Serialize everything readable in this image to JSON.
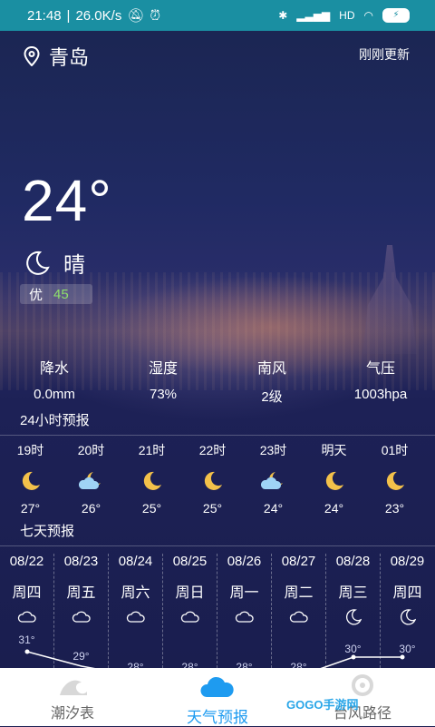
{
  "status_bar": {
    "time": "21:48",
    "speed": "26.0K/s",
    "signal_icons": [
      "bluetooth-icon",
      "cellular-icon",
      "hd-icon",
      "wifi-icon",
      "battery-icon"
    ],
    "battery_icon": "battery-charging-icon"
  },
  "header": {
    "location": "青岛",
    "updated": "刚刚更新"
  },
  "current": {
    "temperature": "24°",
    "condition": "晴",
    "condition_icon": "moon-icon",
    "aqi_label": "优",
    "aqi_value": "45"
  },
  "stats": [
    {
      "label": "降水",
      "value": "0.0mm"
    },
    {
      "label": "湿度",
      "value": "73%"
    },
    {
      "label": "南风",
      "value": "2级"
    },
    {
      "label": "气压",
      "value": "1003hpa"
    }
  ],
  "hourly_title": "24小时预报",
  "hourly": [
    {
      "time": "19时",
      "icon": "moon-icon",
      "temp": "27°"
    },
    {
      "time": "20时",
      "icon": "cloudy-night-icon",
      "temp": "26°"
    },
    {
      "time": "21时",
      "icon": "moon-icon",
      "temp": "25°"
    },
    {
      "time": "22时",
      "icon": "moon-icon",
      "temp": "25°"
    },
    {
      "time": "23时",
      "icon": "cloudy-night-icon",
      "temp": "24°"
    },
    {
      "time": "明天",
      "icon": "moon-icon",
      "temp": "24°"
    },
    {
      "time": "01时",
      "icon": "moon-icon",
      "temp": "23°"
    }
  ],
  "daily_title": "七天预报",
  "daily": [
    {
      "date": "08/22",
      "weekday": "周四",
      "icon": "cloudy-icon",
      "high": "31°"
    },
    {
      "date": "08/23",
      "weekday": "周五",
      "icon": "cloudy-icon",
      "high": "29°"
    },
    {
      "date": "08/24",
      "weekday": "周六",
      "icon": "cloudy-icon",
      "high": "28°"
    },
    {
      "date": "08/25",
      "weekday": "周日",
      "icon": "cloudy-icon",
      "high": "28°"
    },
    {
      "date": "08/26",
      "weekday": "周一",
      "icon": "cloudy-icon",
      "high": "28°"
    },
    {
      "date": "08/27",
      "weekday": "周二",
      "icon": "cloudy-icon",
      "high": "28°"
    },
    {
      "date": "08/28",
      "weekday": "周三",
      "icon": "moon-icon",
      "high": "30°"
    },
    {
      "date": "08/29",
      "weekday": "周四",
      "icon": "moon-icon",
      "high": "30°"
    }
  ],
  "tabs": [
    {
      "label": "潮汐表",
      "icon": "wave-icon",
      "active": false
    },
    {
      "label": "天气预报",
      "icon": "cloud-icon",
      "active": true
    },
    {
      "label": "台风路径",
      "icon": "typhoon-icon",
      "active": false
    }
  ],
  "watermark": "GOGO手游网",
  "colors": {
    "status_bar": "#1a8fa2",
    "accent": "#1e9bf0",
    "aqi_good": "#8ee06b",
    "moon": "#f3c14a"
  }
}
